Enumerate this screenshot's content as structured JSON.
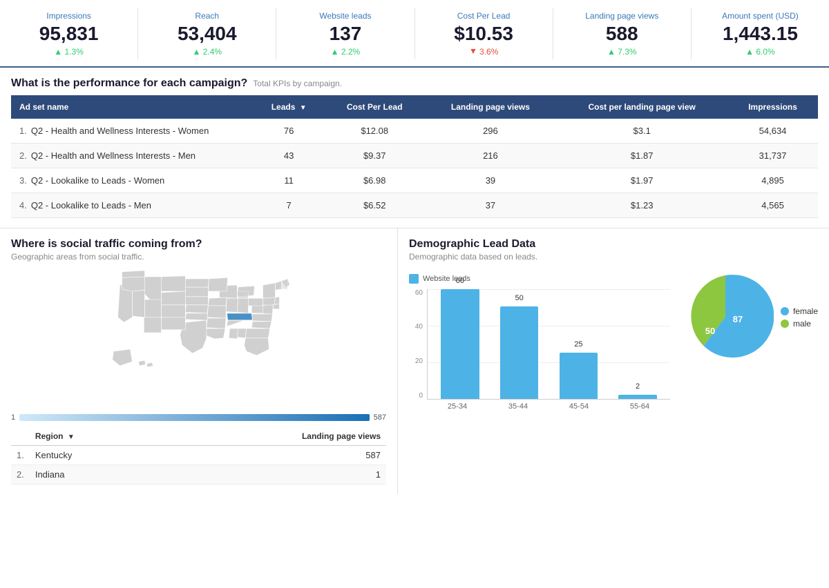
{
  "kpis": [
    {
      "label": "Impressions",
      "value": "95,831",
      "change": "1.3%",
      "direction": "up"
    },
    {
      "label": "Reach",
      "value": "53,404",
      "change": "2.4%",
      "direction": "up"
    },
    {
      "label": "Website leads",
      "value": "137",
      "change": "2.2%",
      "direction": "up"
    },
    {
      "label": "Cost Per Lead",
      "value": "$10.53",
      "change": "3.6%",
      "direction": "down"
    },
    {
      "label": "Landing page views",
      "value": "588",
      "change": "7.3%",
      "direction": "up"
    },
    {
      "label": "Amount spent (USD)",
      "value": "1,443.15",
      "change": "6.0%",
      "direction": "up"
    }
  ],
  "campaign_section": {
    "title": "What is the performance for each campaign?",
    "subtitle": "Total KPIs by campaign.",
    "columns": [
      "Ad set name",
      "Leads",
      "Cost Per Lead",
      "Landing page views",
      "Cost per landing page view",
      "Impressions"
    ],
    "rows": [
      {
        "num": "1.",
        "name": "Q2 - Health and Wellness Interests - Women",
        "leads": "76",
        "cpl": "$12.08",
        "lpv": "296",
        "cplpv": "$3.1",
        "impressions": "54,634"
      },
      {
        "num": "2.",
        "name": "Q2 - Health and Wellness Interests - Men",
        "leads": "43",
        "cpl": "$9.37",
        "lpv": "216",
        "cplpv": "$1.87",
        "impressions": "31,737"
      },
      {
        "num": "3.",
        "name": "Q2 - Lookalike to Leads - Women",
        "leads": "11",
        "cpl": "$6.98",
        "lpv": "39",
        "cplpv": "$1.97",
        "impressions": "4,895"
      },
      {
        "num": "4.",
        "name": "Q2 - Lookalike to Leads - Men",
        "leads": "7",
        "cpl": "$6.52",
        "lpv": "37",
        "cplpv": "$1.23",
        "impressions": "4,565"
      }
    ]
  },
  "traffic_section": {
    "title": "Where is social traffic coming from?",
    "subtitle": "Geographic areas from social traffic.",
    "scale_min": "1",
    "scale_max": "587",
    "region_columns": [
      "Region",
      "Landing page views"
    ],
    "regions": [
      {
        "num": "1.",
        "name": "Kentucky",
        "views": "587"
      },
      {
        "num": "2.",
        "name": "Indiana",
        "views": "1"
      }
    ]
  },
  "demographic_section": {
    "title": "Demographic Lead Data",
    "subtitle": "Demographic data based on leads.",
    "legend": [
      {
        "label": "female",
        "color": "#4db3e6"
      },
      {
        "label": "male",
        "color": "#8dc63f"
      }
    ],
    "bar_legend_label": "Website leads",
    "bars": [
      {
        "label": "25-34",
        "value": 60,
        "display": "60"
      },
      {
        "label": "35-44",
        "value": 50,
        "display": "50"
      },
      {
        "label": "45-54",
        "value": 25,
        "display": "25"
      },
      {
        "label": "55-64",
        "value": 2,
        "display": "2"
      }
    ],
    "y_axis": [
      "0",
      "20",
      "40",
      "60"
    ],
    "donut": {
      "female_value": 87,
      "male_value": 50,
      "female_label": "87",
      "male_label": "50",
      "female_color": "#4db3e6",
      "male_color": "#8dc63f"
    }
  }
}
